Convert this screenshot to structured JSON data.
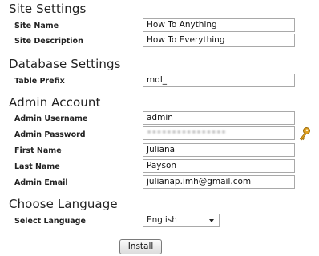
{
  "site_settings": {
    "heading": "Site Settings",
    "site_name_label": "Site Name",
    "site_name_value": "How To Anything",
    "site_description_label": "Site Description",
    "site_description_value": "How To Everything"
  },
  "database_settings": {
    "heading": "Database Settings",
    "table_prefix_label": "Table Prefix",
    "table_prefix_value": "mdl_"
  },
  "admin_account": {
    "heading": "Admin Account",
    "username_label": "Admin Username",
    "username_value": "admin",
    "password_label": "Admin Password",
    "password_value": "••••••••••••••••",
    "first_name_label": "First Name",
    "first_name_value": "Juliana",
    "last_name_label": "Last Name",
    "last_name_value": "Payson",
    "email_label": "Admin Email",
    "email_value": "julianap.imh@gmail.com"
  },
  "language": {
    "heading": "Choose Language",
    "select_label": "Select Language",
    "selected": "English"
  },
  "install_label": "Install",
  "colors": {
    "key_icon": "#e0a020"
  },
  "icons": {
    "password_generator": "key-icon",
    "dropdown": "chevron-down-icon"
  }
}
